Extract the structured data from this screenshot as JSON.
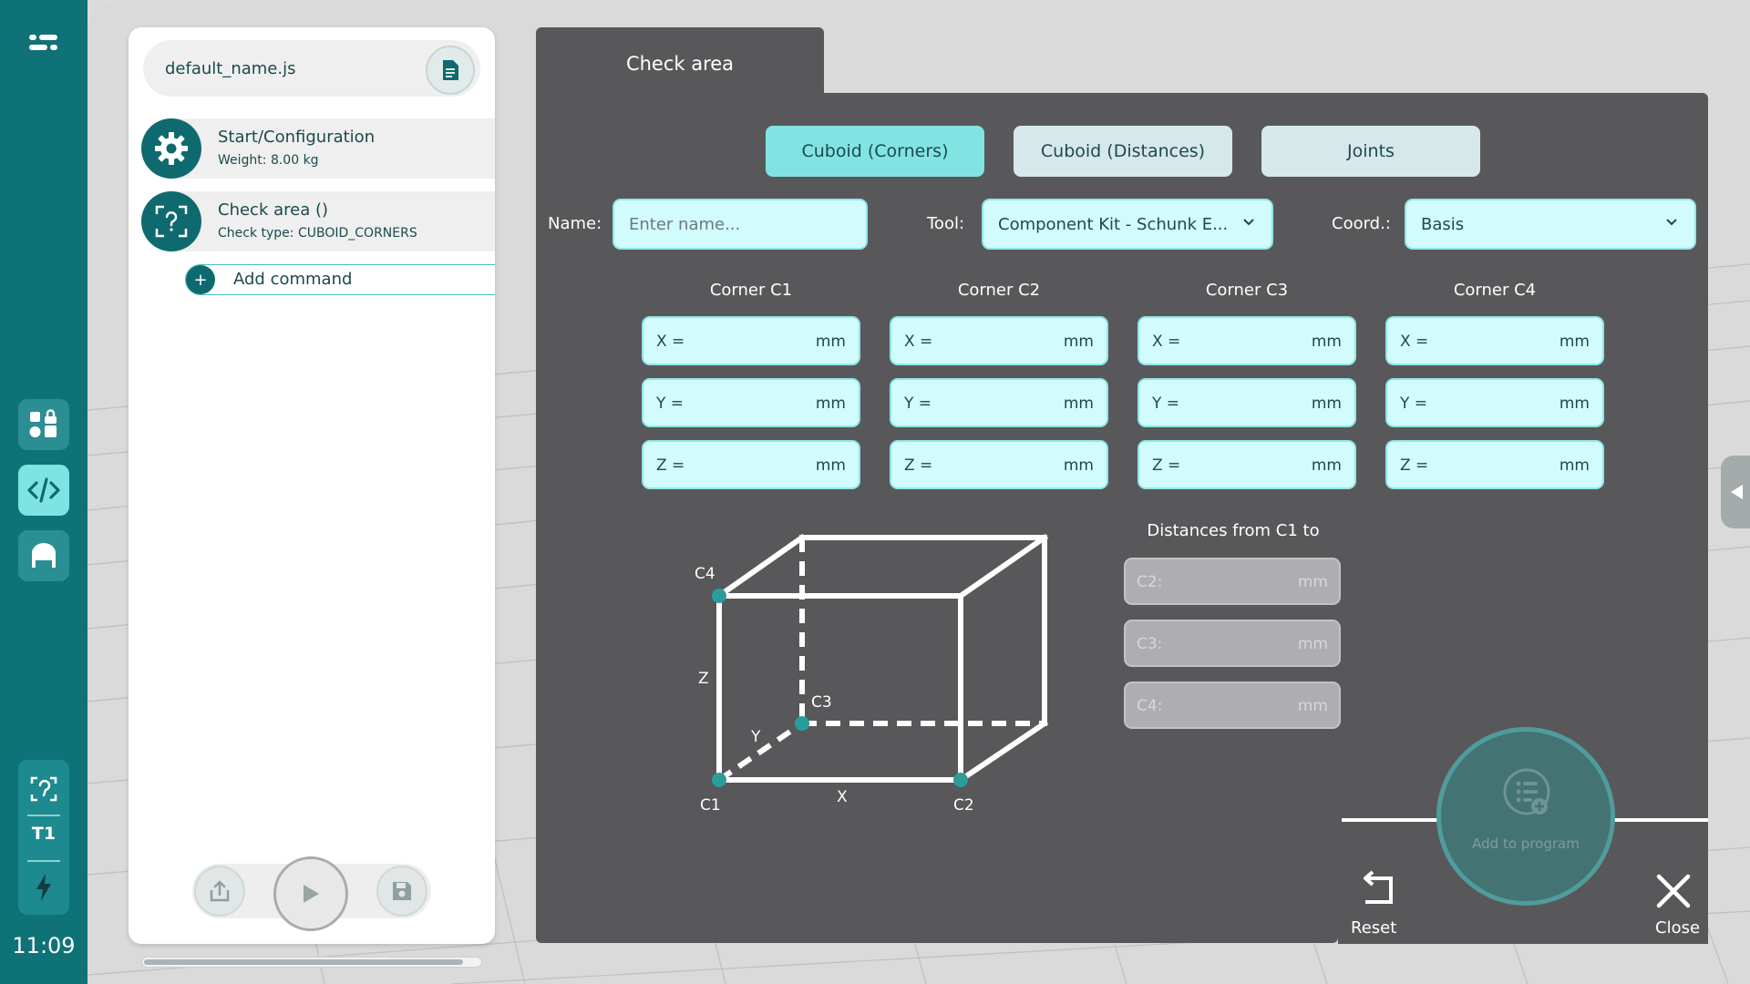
{
  "rail": {
    "clock": "11:09",
    "items": [
      {
        "name": "Apps",
        "icon": "apps-icon"
      },
      {
        "name": "Code",
        "icon": "code-icon"
      },
      {
        "name": "Home",
        "icon": "home-icon"
      }
    ],
    "mode_label": "T1"
  },
  "program": {
    "filename": "default_name.js",
    "commands": [
      {
        "title": "Start/Configuration",
        "subtitle": "Weight: 8.00 kg",
        "icon": "gear-icon"
      },
      {
        "title": "Check area ()",
        "subtitle": "Check type: CUBOID_CORNERS",
        "icon": "check-area-icon"
      }
    ],
    "add_command_label": "Add command"
  },
  "dialog": {
    "tab_title": "Check area",
    "modes": [
      {
        "label": "Cuboid (Corners)",
        "active": true
      },
      {
        "label": "Cuboid (Distances)",
        "active": false
      },
      {
        "label": "Joints",
        "active": false
      }
    ],
    "name_label": "Name:",
    "name_placeholder": "Enter name...",
    "tool_label": "Tool:",
    "tool_value": "Component Kit - Schunk E...",
    "coord_label": "Coord.:",
    "coord_value": "Basis",
    "corners": [
      {
        "header": "Corner C1",
        "x": "X =",
        "y": "Y =",
        "z": "Z =",
        "unit": "mm"
      },
      {
        "header": "Corner C2",
        "x": "X =",
        "y": "Y =",
        "z": "Z =",
        "unit": "mm"
      },
      {
        "header": "Corner C3",
        "x": "X =",
        "y": "Y =",
        "z": "Z =",
        "unit": "mm"
      },
      {
        "header": "Corner C4",
        "x": "X =",
        "y": "Y =",
        "z": "Z =",
        "unit": "mm"
      }
    ],
    "distances_header": "Distances from C1 to",
    "distances": [
      {
        "label": "C2:",
        "unit": "mm"
      },
      {
        "label": "C3:",
        "unit": "mm"
      },
      {
        "label": "C4:",
        "unit": "mm"
      }
    ],
    "diagram_labels": {
      "c1": "C1",
      "c2": "C2",
      "c3": "C3",
      "c4": "C4",
      "x": "X",
      "y": "Y",
      "z": "Z"
    },
    "accent": "#2a9d9a"
  },
  "actions": {
    "reset": "Reset",
    "add_to_program": "Add to program",
    "close": "Close"
  }
}
